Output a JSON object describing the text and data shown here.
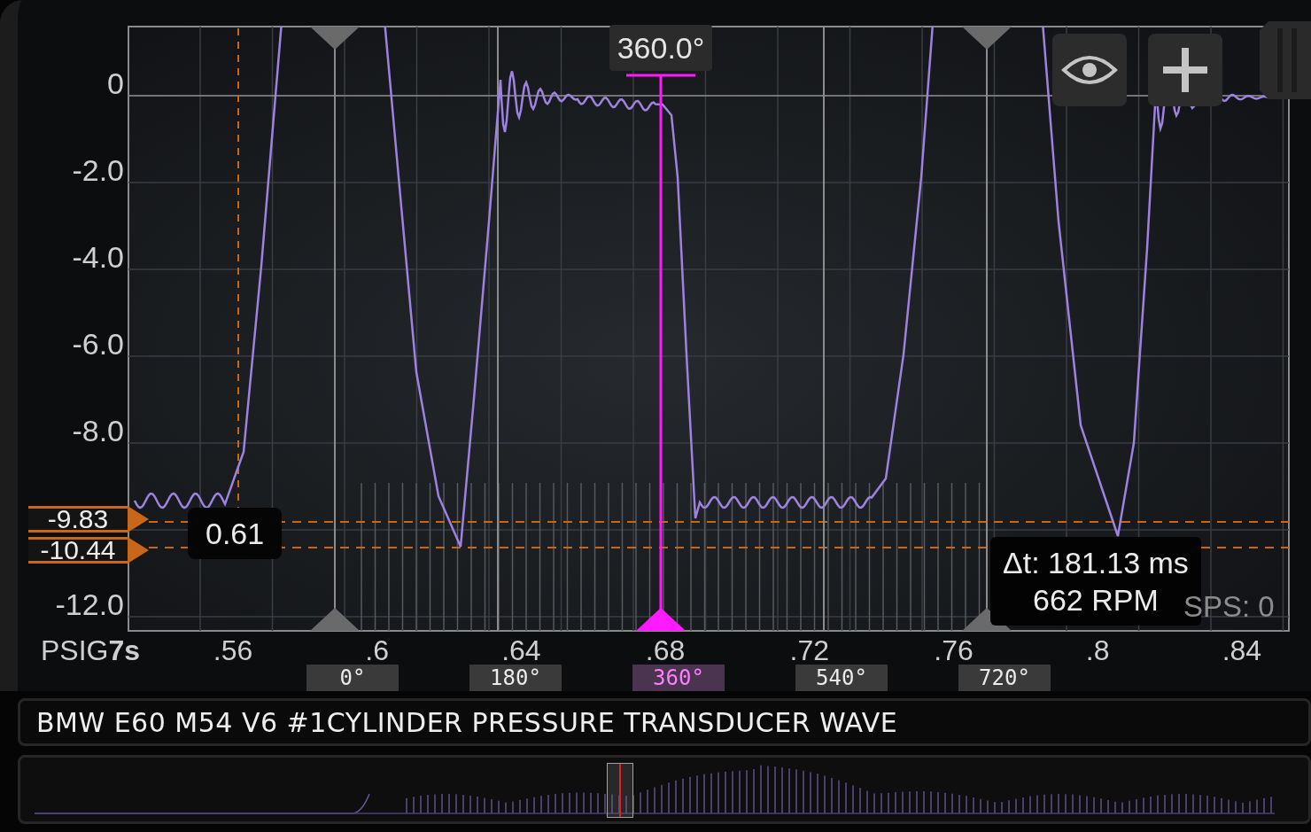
{
  "y_axis": {
    "ticks": [
      "0",
      "-2.0",
      "-4.0",
      "-6.0",
      "-8.0",
      "-12.0"
    ]
  },
  "x_axis": {
    "unit": "PSIG**7s**",
    "ticks": [
      ".56",
      ".6",
      ".64",
      ".68",
      ".72",
      ".76",
      ".8",
      ".84"
    ]
  },
  "level_cursors": [
    {
      "value": "-9.83"
    },
    {
      "value": "-10.44"
    }
  ],
  "cursor_difference": "0.61",
  "phase_readout": "360.0°",
  "phase_markers": [
    {
      "label": "0°",
      "selected": false
    },
    {
      "label": "180°",
      "selected": false
    },
    {
      "label": "360°",
      "selected": true
    },
    {
      "label": "540°",
      "selected": false
    },
    {
      "label": "720°",
      "selected": false
    }
  ],
  "measurement": {
    "delta_t": "Δt: 181.13 ms",
    "rpm": "662 RPM"
  },
  "sps": "SPS: 0",
  "title": "BMW E60 M54 V6 #1CYLINDER PRESSURE TRANSDUCER WAVE"
}
